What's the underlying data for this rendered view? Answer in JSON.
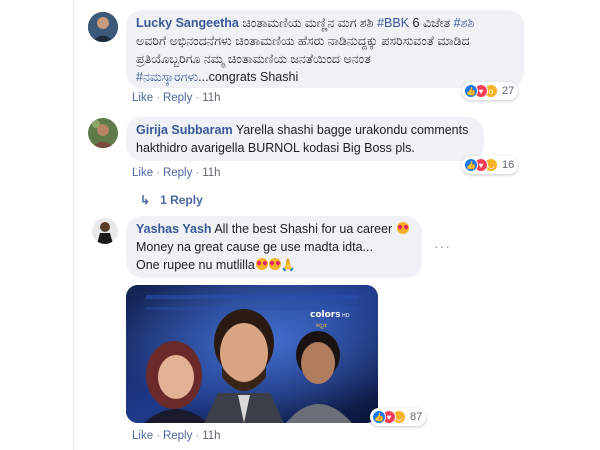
{
  "comments": [
    {
      "author": "Lucky Sangeetha",
      "text_line1_pre": "ಚಿಂತಾಮಣಿಯ ಮಣ್ಣಿನ ಮಗ ಶಶಿ ",
      "text_line1_tag1": "#BBK",
      "text_line1_mid": " 6 ವಿಜೇತ ",
      "text_line1_tag2": "#ಶಶಿ",
      "text_line2": "ಅವರಿಗೆ ಅಭಿನಂದನೆಗಳು ಚಿಂತಾಮಣಿಯ ಹೆಸರು ನಾಡಿನುದ್ದಕ್ಕು ಪಸರಿಸುವಂತೆ ಮಾಡಿದ",
      "text_line3": "ಪ್ರತಿಯೊಬ್ಬರಿಗೂ ನಮ್ಮ ಚಿಂತಾಮಣಿಯ ಜನತೆಯಿಂದ ಅನಂತ",
      "text_line4_tag": "#ನಮಸ್ಕಾರಗಳು",
      "text_line4_rest": "...congrats Shashi",
      "reaction_count": "27",
      "like": "Like",
      "reply": "Reply",
      "time": "11h"
    },
    {
      "author": "Girija Subbaram",
      "text_line1": "Yarella shashi bagge urakondu comments",
      "text_line2": "hakthidro avarigella BURNOL kodasi Big Boss pls.",
      "reaction_count": "16",
      "like": "Like",
      "reply": "Reply",
      "time": "11h",
      "replies_label": "1 Reply"
    },
    {
      "author": "Yashas Yash",
      "text_line1": "All the best Shashi for ua career",
      "text_line2": "Money na great cause ge use madta idta...",
      "text_line3": "One rupee nu mutlilla",
      "more_label": "···",
      "photo_logo_top": "colors",
      "photo_logo_hd": "HD",
      "photo_logo_bottom": "ಕನ್ನಡ",
      "reaction_count": "87",
      "like": "Like",
      "reply": "Reply",
      "time": "11h"
    }
  ],
  "colors": {
    "link": "#385898",
    "bubble": "#eff1f4",
    "like_blue": "#1877f2",
    "love_red": "#f33e58",
    "wow_yellow": "#f7b125"
  }
}
